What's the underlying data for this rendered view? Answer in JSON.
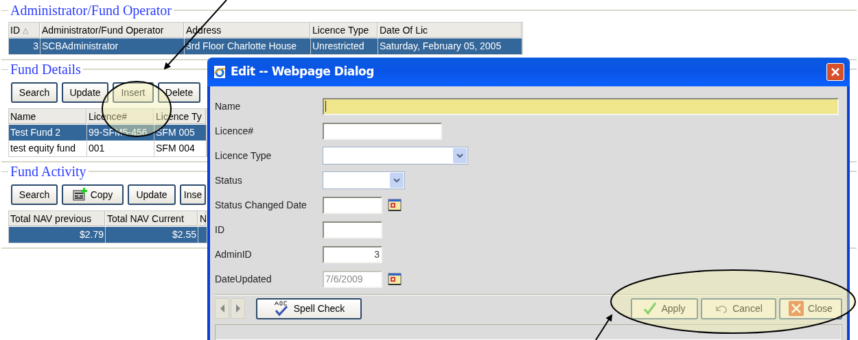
{
  "sections": [
    {
      "title": "Administrator/Fund Operator",
      "table": {
        "columns": [
          {
            "label": "ID",
            "sort_glyph": "△"
          },
          {
            "label": "Administrator/Fund Operator"
          },
          {
            "label": "Address"
          },
          {
            "label": "Licence Type"
          },
          {
            "label": "Date Of Lic"
          }
        ],
        "rows": [
          {
            "selected": true,
            "cells": [
              "3",
              "SCBAdministrator",
              "3rd Floor Charlotte House",
              "Unrestricted",
              "Saturday, February 05, 2005"
            ]
          }
        ]
      }
    },
    {
      "title": "Fund Details",
      "buttons": [
        {
          "label": "Search",
          "kind": "plain"
        },
        {
          "label": "Update",
          "kind": "plain"
        },
        {
          "label": "Insert",
          "kind": "plain"
        },
        {
          "label": "Delete",
          "kind": "plain"
        }
      ],
      "table": {
        "columns": [
          {
            "label": "Name"
          },
          {
            "label": "Licence#"
          },
          {
            "label": "Licence Ty"
          }
        ],
        "rows": [
          {
            "selected": true,
            "cells": [
              "Test Fund 2",
              "99-SFM5-456",
              "SFM 005"
            ]
          },
          {
            "selected": false,
            "cells": [
              "test equity fund",
              "001",
              "SFM 004"
            ]
          }
        ]
      }
    },
    {
      "title": "Fund Activity",
      "buttons": [
        {
          "label": "Search",
          "kind": "plain"
        },
        {
          "label": "Copy",
          "kind": "copy"
        },
        {
          "label": "Update",
          "kind": "plain"
        },
        {
          "label": "Inse",
          "kind": "plain"
        }
      ],
      "table": {
        "columns": [
          {
            "label": "Total NAV previous"
          },
          {
            "label": "Total NAV Current"
          },
          {
            "label": "N"
          }
        ],
        "rows": [
          {
            "selected": true,
            "cells": [
              "$2.79",
              "$2.55"
            ]
          }
        ]
      }
    }
  ],
  "dialog": {
    "title": "Edit -- Webpage Dialog",
    "fields": [
      {
        "label": "Name",
        "kind": "text",
        "focused": true,
        "disabled": false
      },
      {
        "label": "Licence#",
        "kind": "text",
        "focused": false,
        "disabled": false
      },
      {
        "label": "Licence Type",
        "kind": "select",
        "focused": false,
        "disabled": false
      },
      {
        "label": "Status",
        "kind": "select",
        "focused": false,
        "disabled": false
      },
      {
        "label": "Status Changed Date",
        "kind": "date",
        "focused": false,
        "disabled": false
      },
      {
        "label": "ID",
        "kind": "text",
        "focused": false,
        "disabled": false
      },
      {
        "label": "AdminID",
        "kind": "number",
        "value": "3",
        "focused": false,
        "disabled": false
      },
      {
        "label": "DateUpdated",
        "kind": "date",
        "value": "7/6/2009",
        "focused": false,
        "disabled": true
      }
    ],
    "buttons": [
      {
        "label": "Spell Check",
        "kind": "spell"
      },
      {
        "label": "Apply",
        "kind": "apply"
      },
      {
        "label": "Cancel",
        "kind": "cancel"
      },
      {
        "label": "Close",
        "kind": "close"
      }
    ]
  }
}
